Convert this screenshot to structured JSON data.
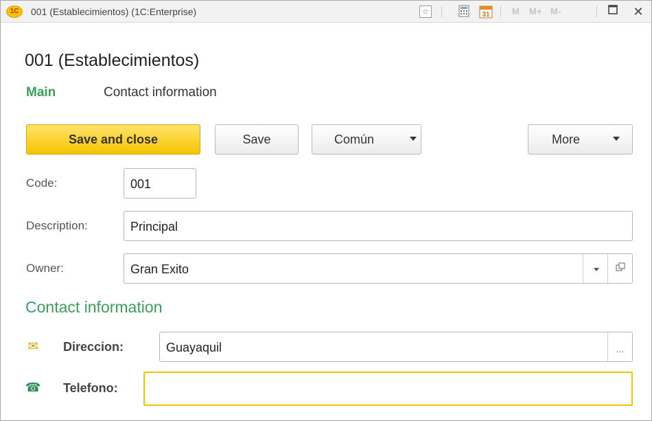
{
  "titlebar": {
    "logo_text": "1C",
    "title": "001 (Establecimientos)  (1C:Enterprise)",
    "icons": [
      "favorite-icon",
      "calculator-icon",
      "calendar-icon",
      "maximize-icon",
      "close-icon"
    ],
    "memory_buttons": [
      "M",
      "M+",
      "M-"
    ],
    "calendar_day": "31"
  },
  "page": {
    "title": "001 (Establecimientos)"
  },
  "tabs": [
    {
      "label": "Main",
      "active": true
    },
    {
      "label": "Contact information",
      "active": false
    }
  ],
  "toolbar": {
    "save_close_label": "Save and close",
    "save_label": "Save",
    "comun_label": "Común",
    "more_label": "More"
  },
  "form": {
    "code": {
      "label": "Code:",
      "value": "001"
    },
    "description": {
      "label": "Description:",
      "value": "Principal"
    },
    "owner": {
      "label": "Owner:",
      "value": "Gran Exito"
    }
  },
  "contact": {
    "section_title": "Contact information",
    "direccion": {
      "label": "Direccion:",
      "value": "Guayaquil",
      "button": "..."
    },
    "telefono": {
      "label": "Telefono:",
      "value": ""
    }
  },
  "colors": {
    "accent_green": "#3aa05a",
    "primary_yellow": "#f5c400",
    "focus_border": "#f5c400"
  }
}
